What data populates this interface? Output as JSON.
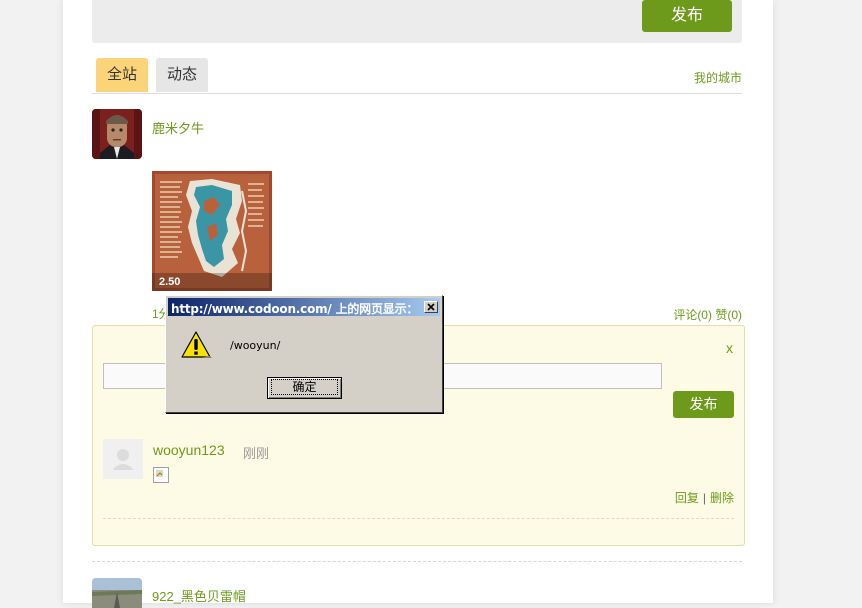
{
  "compose": {
    "publish_label": "发布"
  },
  "tabs": [
    {
      "label": "全站",
      "active": true
    },
    {
      "label": "动态",
      "active": false
    }
  ],
  "my_city_label": "我的城市",
  "post": {
    "user": "鹿米夕牛",
    "time": "1分",
    "image_caption": "2.50",
    "comment_label": "评论(0)",
    "like_label": "赞(0)"
  },
  "comment_box": {
    "close_label": "x",
    "input_value": "",
    "publish_label": "发布",
    "comment": {
      "user": "wooyun123",
      "time": "刚刚",
      "reply_label": "回复",
      "separator": "|",
      "delete_label": "删除"
    }
  },
  "next_post": {
    "user": "922_黑色贝雷帽"
  },
  "dialog": {
    "title": "http://www.codoon.com/ 上的网页显示：",
    "message": "/wooyun/",
    "ok_label": "确定",
    "icon": "warning-icon"
  },
  "colors": {
    "accent_green": "#6e9a1c",
    "active_tab": "#fbd47a",
    "comment_bg": "#fdfbe6",
    "dialog_titlebar": "#0a246a"
  }
}
